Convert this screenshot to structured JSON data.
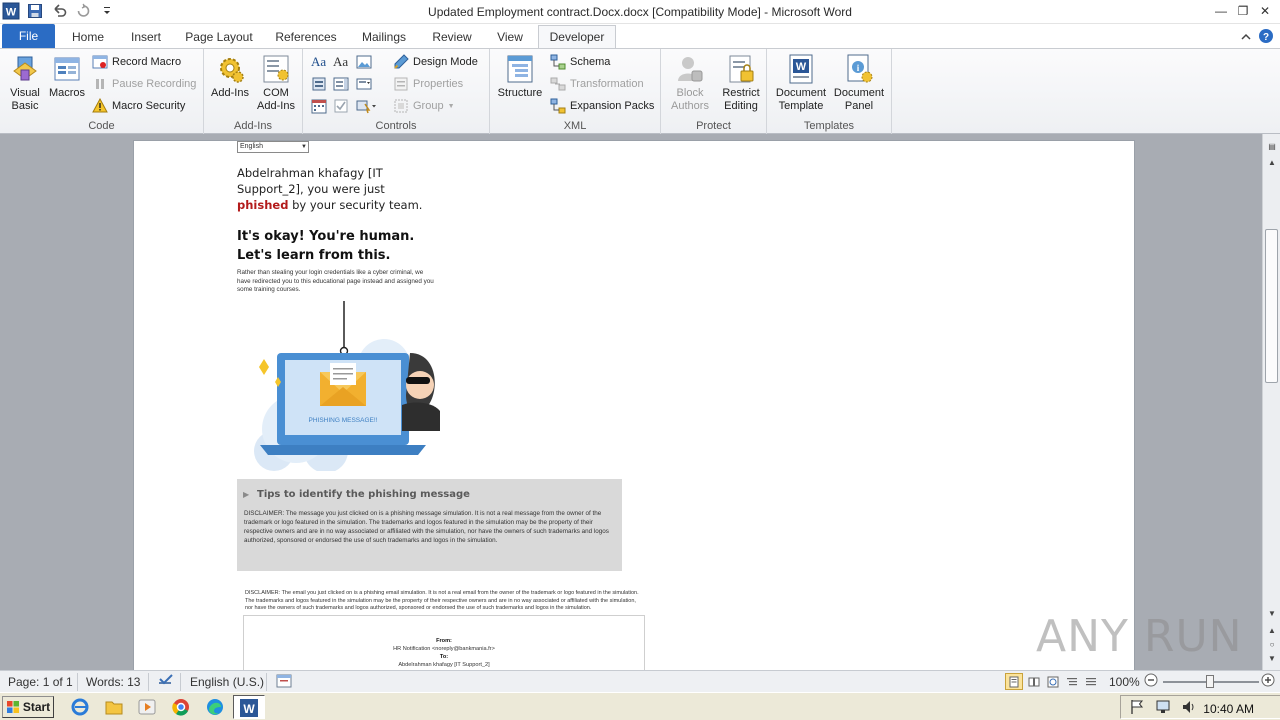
{
  "window": {
    "title": "Updated Employment contract.Docx.docx [Compatibility Mode]  -  Microsoft Word"
  },
  "tabs": [
    "File",
    "Home",
    "Insert",
    "Page Layout",
    "References",
    "Mailings",
    "Review",
    "View",
    "Developer"
  ],
  "active_tab": "Developer",
  "ribbon": {
    "code": {
      "label": "Code",
      "visual_basic": [
        "Visual",
        "Basic"
      ],
      "macros": "Macros",
      "record_macro": "Record Macro",
      "pause_recording": "Pause Recording",
      "macro_security": "Macro Security"
    },
    "addins": {
      "label": "Add-Ins",
      "addins": "Add-Ins",
      "com_addins": [
        "COM",
        "Add-Ins"
      ]
    },
    "controls": {
      "label": "Controls",
      "design_mode": "Design Mode",
      "properties": "Properties",
      "group": "Group"
    },
    "xml": {
      "label": "XML",
      "structure": "Structure",
      "schema": "Schema",
      "transformation": "Transformation",
      "expansion_packs": "Expansion Packs"
    },
    "protect": {
      "label": "Protect",
      "block_authors": [
        "Block",
        "Authors"
      ],
      "restrict_editing": [
        "Restrict",
        "Editing"
      ]
    },
    "templates": {
      "label": "Templates",
      "document_template": [
        "Document",
        "Template"
      ],
      "document_panel": [
        "Document",
        "Panel"
      ]
    }
  },
  "document": {
    "language_select": "English",
    "greeting_part1": "Abdelrahman khafagy [IT Support_2], you were just ",
    "greeting_phished": "phished",
    "greeting_part2": " by your security team.",
    "headline": "It's okay! You're human. Let's learn from this.",
    "subtext": "Rather than stealing your login credentials like a cyber criminal, we have redirected you to this educational page instead and assigned you some training courses.",
    "illustration_caption": "PHISHING MESSAGE!!",
    "tips_title": "Tips to identify the phishing message",
    "tips_body": "DISCLAIMER: The message you just clicked on is a phishing message simulation. It is not a real message from the owner of the trademark or logo featured in the simulation. The trademarks and logos featured in the simulation may be the property of their respective owners and are in no way associated or affiliated with the simulation, nor have the owners of such trademarks and logos authorized, sponsored or endorsed the use of such trademarks and logos in the simulation.",
    "disclaimer2": "DISCLAIMER: The email you just clicked on is a phishing email simulation. It is not a real email from the owner of the trademark or logo featured in the simulation. The trademarks and logos featured in the simulation may be the property of their respective owners and are in no way associated or affiliated with the simulation, nor have the owners of such trademarks and logos authorized, sponsored or endorsed the use of such trademarks and logos in the simulation.",
    "mail_from_label": "From:",
    "mail_from_value": "HR Notification <noreply@bankmania.fr>",
    "mail_to_label": "To:",
    "mail_to_value": "Abdelrahman khafagy [IT Support_2]"
  },
  "watermark": "ANY  RUN",
  "statusbar": {
    "page": "Page: 1 of 1",
    "words": "Words: 13",
    "language": "English (U.S.)",
    "zoom": "100%"
  },
  "taskbar": {
    "start": "Start",
    "clock": "10:40 AM"
  },
  "colors": {
    "file_tab": "#2b6cc4",
    "phished": "#b31b1b",
    "workspace": "#a8acb3"
  }
}
